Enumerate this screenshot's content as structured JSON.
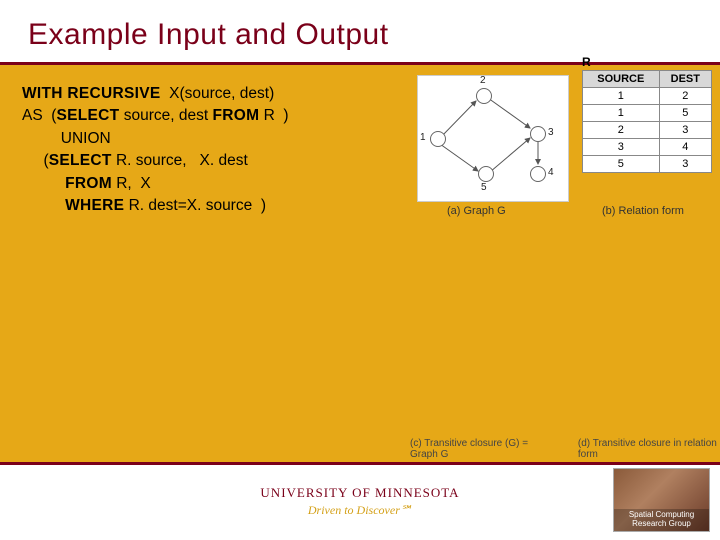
{
  "title": "Example Input and Output",
  "sql": {
    "l1a": "WITH RECURSIVE",
    "l1b": "  X(source, dest)",
    "l2a": "AS  (",
    "l2b": "SELECT",
    "l2c": " source, dest ",
    "l2d": "FROM",
    "l2e": " R  )",
    "l3": "         UNION",
    "l4a": "     (",
    "l4b": "SELECT",
    "l4c": " R. source,   X. dest",
    "l5a": "          ",
    "l5b": "FROM",
    "l5c": " R,  X",
    "l6a": "          ",
    "l6b": "WHERE",
    "l6c": " R. dest=X. source  )"
  },
  "graph": {
    "caption": "(a) Graph G",
    "nodes": [
      "1",
      "2",
      "3",
      "4",
      "5"
    ]
  },
  "relation": {
    "label": "R",
    "headers": [
      "SOURCE",
      "DEST"
    ],
    "rows": [
      [
        "1",
        "2"
      ],
      [
        "1",
        "5"
      ],
      [
        "2",
        "3"
      ],
      [
        "3",
        "4"
      ],
      [
        "5",
        "3"
      ]
    ],
    "caption": "(b) Relation form"
  },
  "bottom": {
    "c": "(c) Transitive closure (G) = Graph G",
    "d": "(d) Transitive closure in relation form"
  },
  "footer": {
    "univ": "UNIVERSITY OF MINNESOTA",
    "tagline": "Driven to Discover℠",
    "group1": "Spatial Computing",
    "group2": "Research Group"
  }
}
